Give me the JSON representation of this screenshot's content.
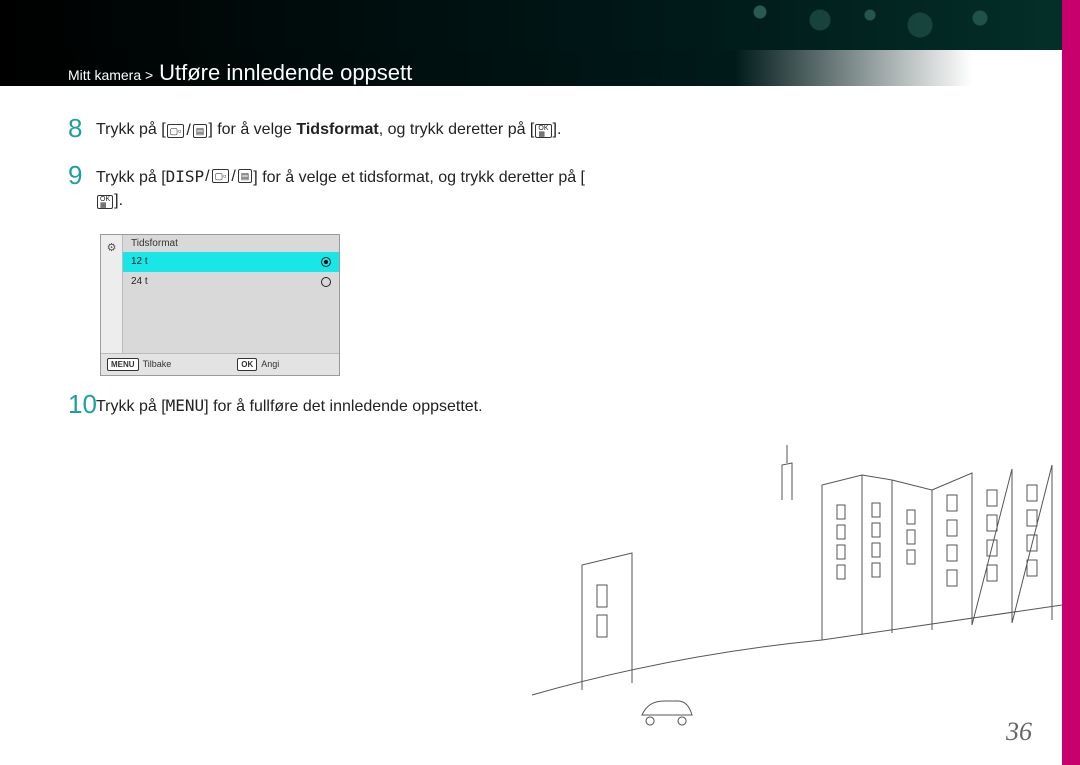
{
  "breadcrumb": {
    "section": "Mitt kamera",
    "sep": ">",
    "title": "Utføre innledende oppsett"
  },
  "steps": {
    "s8": {
      "num": "8",
      "pre": "Trykk på [",
      "mid": "] for å velge ",
      "bold": "Tidsformat",
      "post": ", og trykk deretter på [",
      "end": "]."
    },
    "s9": {
      "num": "9",
      "pre": "Trykk på [",
      "mid": "] for å velge et tidsformat, og trykk deretter på [",
      "end": "]."
    },
    "s10": {
      "num": "10",
      "text_pre": "Trykk på [",
      "text_post": "] for å fullføre det innledende oppsettet."
    }
  },
  "keys": {
    "disp": "DISP",
    "menu": "MENU",
    "ok": "OK",
    "af": "▢▫",
    "burst": "▤"
  },
  "screen": {
    "title": "Tidsformat",
    "opt1": "12 t",
    "opt2": "24 t",
    "back_btn": "MENU",
    "back_lbl": "Tilbake",
    "ok_btn": "OK",
    "ok_lbl": "Angi"
  },
  "page": "36"
}
